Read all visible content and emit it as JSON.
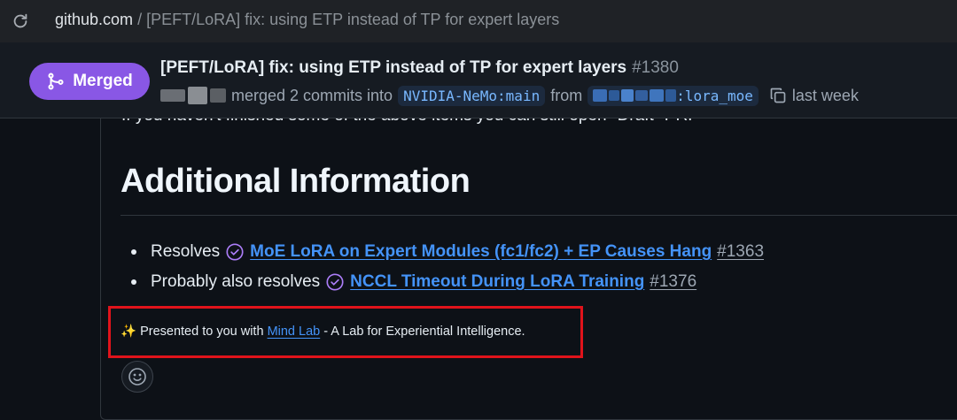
{
  "browser": {
    "url_host": "github.com",
    "url_rest": " / [PEFT/LoRA] fix: using ETP instead of TP for expert layers"
  },
  "pr": {
    "status": "Merged",
    "title": "[PEFT/LoRA] fix: using ETP instead of TP for expert layers",
    "number": "#1380",
    "merged_text": "merged 2 commits into",
    "base_branch": "NVIDIA-NeMo:main",
    "from_text": "from",
    "head_branch_suffix": ":lora_moe",
    "time": "last week",
    "accent_color": "#8957e5"
  },
  "body": {
    "clipped_text": "If you haven't finished some of the above items you can still open \"Draft\" PR.",
    "heading": "Additional Information",
    "items": [
      {
        "prefix": "Resolves",
        "link": "MoE LoRA on Expert Modules (fc1/fc2) + EP Causes Hang",
        "number": "#1363"
      },
      {
        "prefix": "Probably also resolves",
        "link": "NCCL Timeout During LoRA Training",
        "number": "#1376"
      }
    ],
    "presented_prefix": "✨ Presented to you with ",
    "presented_link": "Mind Lab",
    "presented_suffix": " - A Lab for Experiential Intelligence."
  }
}
